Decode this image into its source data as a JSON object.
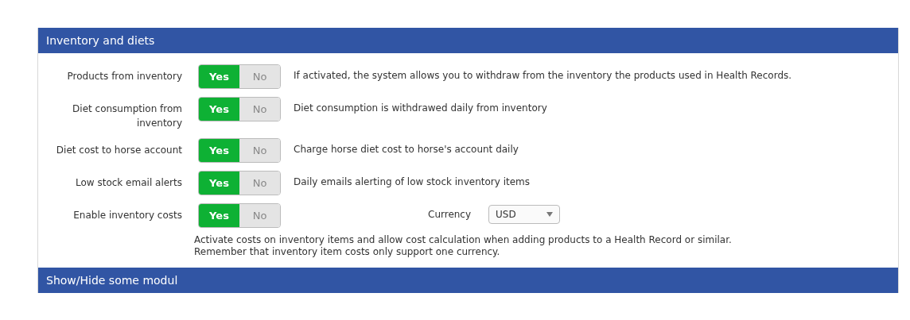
{
  "section": {
    "title": "Inventory and diets"
  },
  "settings": [
    {
      "label": "Products from inventory",
      "options": [
        {
          "label": "Yes",
          "selected": true
        },
        {
          "label": "No",
          "selected": false
        }
      ],
      "description": "If activated, the system allows you to withdraw from the inventory the products used in Health Records."
    },
    {
      "label": "Diet consumption from inventory",
      "options": [
        {
          "label": "Yes",
          "selected": true
        },
        {
          "label": "No",
          "selected": false
        }
      ],
      "description": "Diet consumption is withdrawed daily from inventory"
    },
    {
      "label": "Diet cost to horse account",
      "options": [
        {
          "label": "Yes",
          "selected": true
        },
        {
          "label": "No",
          "selected": false
        }
      ],
      "description": "Charge horse diet cost to horse's account daily"
    },
    {
      "label": "Low stock email alerts",
      "options": [
        {
          "label": "Yes",
          "selected": true
        },
        {
          "label": "No",
          "selected": false
        }
      ],
      "description": "Daily emails alerting of low stock inventory items"
    },
    {
      "label": "Enable inventory costs",
      "options": [
        {
          "label": "Yes",
          "selected": true
        },
        {
          "label": "No",
          "selected": false
        }
      ],
      "currency": {
        "label": "Currency",
        "value": "USD"
      }
    }
  ],
  "note": [
    "Activate costs on inventory items and allow cost calculation when adding products to a Health Record or similar.",
    "Remember that inventory item costs only support one currency."
  ],
  "next_section": {
    "title": "Show/Hide some modul"
  }
}
